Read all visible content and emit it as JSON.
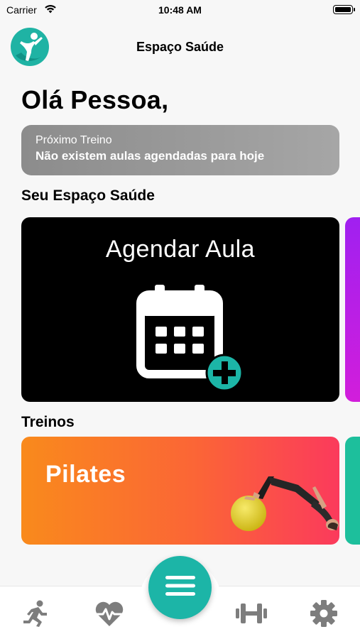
{
  "status_bar": {
    "carrier": "Carrier",
    "time": "10:48 AM"
  },
  "header": {
    "title": "Espaço Saúde",
    "logo_icon": "person-leaf-logo"
  },
  "greeting": "Olá Pessoa,",
  "next_training": {
    "label": "Próximo Treino",
    "value": "Não existem aulas agendadas para hoje"
  },
  "sections": {
    "espaco": "Seu Espaço Saúde",
    "treinos": "Treinos"
  },
  "espaco_cards": [
    {
      "title": "Agendar Aula",
      "icon": "calendar-add-icon"
    }
  ],
  "treino_cards": [
    {
      "title": "Pilates",
      "image": "pilates-exercise-illustration"
    }
  ],
  "tabbar": {
    "items": [
      "running-icon",
      "heartbeat-icon",
      "menu-icon",
      "dumbbell-icon",
      "gear-icon"
    ]
  },
  "colors": {
    "accent": "#1cb5a7",
    "card_dark": "#000000",
    "pilates_start": "#f98a1c",
    "pilates_end": "#fb3a5c",
    "peek_purple": "#c21ee6",
    "peek_teal": "#1dbf9c",
    "icon_gray": "#7d7d7d"
  }
}
